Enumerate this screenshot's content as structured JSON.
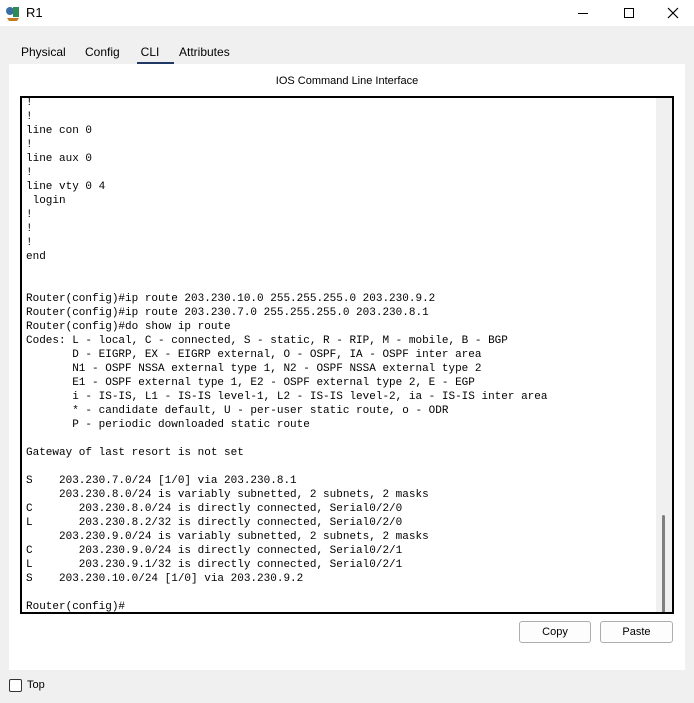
{
  "window": {
    "title": "R1",
    "icon": "router-app-icon",
    "controls": [
      "minimize-icon",
      "maximize-icon",
      "close-icon"
    ]
  },
  "tabs": [
    {
      "label": "Physical"
    },
    {
      "label": "Config"
    },
    {
      "label": "CLI",
      "active": true
    },
    {
      "label": "Attributes"
    }
  ],
  "cli": {
    "heading": "IOS Command Line Interface",
    "output": "!\n!\nline con 0\n!\nline aux 0\n!\nline vty 0 4\n login\n!\n!\n!\nend\n\n\nRouter(config)#ip route 203.230.10.0 255.255.255.0 203.230.9.2\nRouter(config)#ip route 203.230.7.0 255.255.255.0 203.230.8.1\nRouter(config)#do show ip route\nCodes: L - local, C - connected, S - static, R - RIP, M - mobile, B - BGP\n       D - EIGRP, EX - EIGRP external, O - OSPF, IA - OSPF inter area\n       N1 - OSPF NSSA external type 1, N2 - OSPF NSSA external type 2\n       E1 - OSPF external type 1, E2 - OSPF external type 2, E - EGP\n       i - IS-IS, L1 - IS-IS level-1, L2 - IS-IS level-2, ia - IS-IS inter area\n       * - candidate default, U - per-user static route, o - ODR\n       P - periodic downloaded static route\n\nGateway of last resort is not set\n\nS    203.230.7.0/24 [1/0] via 203.230.8.1\n     203.230.8.0/24 is variably subnetted, 2 subnets, 2 masks\nC       203.230.8.0/24 is directly connected, Serial0/2/0\nL       203.230.8.2/32 is directly connected, Serial0/2/0\n     203.230.9.0/24 is variably subnetted, 2 subnets, 2 masks\nC       203.230.9.0/24 is directly connected, Serial0/2/1\nL       203.230.9.1/32 is directly connected, Serial0/2/1\nS    203.230.10.0/24 [1/0] via 203.230.9.2\n\nRouter(config)#",
    "copy_label": "Copy",
    "paste_label": "Paste"
  },
  "footer": {
    "top_label": "Top",
    "top_checked": false
  },
  "colors": {
    "tab_underline": "#1f3864",
    "panel_bg": "#ffffff",
    "window_bg": "#f0f0f0"
  }
}
